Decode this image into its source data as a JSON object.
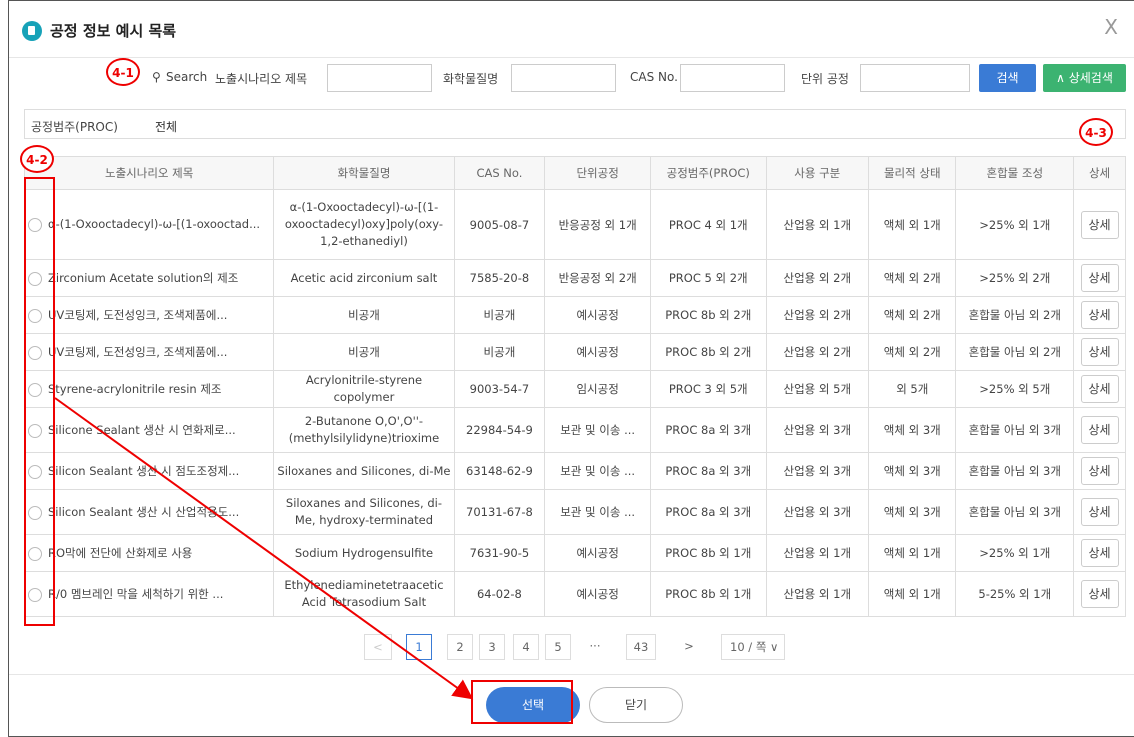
{
  "dialog": {
    "title": "공정 정보 예시 목록",
    "close_glyph": "X"
  },
  "search": {
    "search_label": "Search",
    "scenario_label": "노출시나리오 제목",
    "chemical_label": "화학물질명",
    "cas_label": "CAS No.",
    "unit_label": "단위 공정",
    "search_button": "검색",
    "advanced_button": "∧ 상세검색"
  },
  "filter": {
    "label": "공정범주(PROC)",
    "value": "전체"
  },
  "table": {
    "headers": [
      "노출시나리오 제목",
      "화학물질명",
      "CAS No.",
      "단위공정",
      "공정범주(PROC)",
      "사용 구분",
      "물리적 상태",
      "혼합물 조성",
      "상세"
    ],
    "rows": [
      {
        "title": "α-(1-Oxooctadecyl)-ω-[(1-oxooctad...",
        "chemical": "α-(1-Oxooctadecyl)-ω-[(1-oxooctadecyl)oxy]poly(oxy-1,2-ethanediyl)",
        "cas": "9005-08-7",
        "unit": "반응공정 외 1개",
        "proc": "PROC 4 외 1개",
        "use": "산업용 외 1개",
        "state": "액체 외 1개",
        "mix": ">25% 외 1개",
        "detail": "상세"
      },
      {
        "title": "Zirconium Acetate solution의 제조",
        "chemical": "Acetic acid zirconium salt",
        "cas": "7585-20-8",
        "unit": "반응공정 외 2개",
        "proc": "PROC 5 외 2개",
        "use": "산업용 외 2개",
        "state": "액체 외 2개",
        "mix": ">25% 외 2개",
        "detail": "상세"
      },
      {
        "title": "UV코팅제, 도전성잉크, 조색제품에...",
        "chemical": "비공개",
        "cas": "비공개",
        "unit": "예시공정",
        "proc": "PROC 8b 외 2개",
        "use": "산업용 외 2개",
        "state": "액체 외 2개",
        "mix": "혼합물 아님 외 2개",
        "detail": "상세"
      },
      {
        "title": "UV코팅제, 도전성잉크, 조색제품에...",
        "chemical": "비공개",
        "cas": "비공개",
        "unit": "예시공정",
        "proc": "PROC 8b 외 2개",
        "use": "산업용 외 2개",
        "state": "액체 외 2개",
        "mix": "혼합물 아님 외 2개",
        "detail": "상세"
      },
      {
        "title": "Styrene-acrylonitrile resin 제조",
        "chemical": "Acrylonitrile-styrene copolymer",
        "cas": "9003-54-7",
        "unit": "임시공정",
        "proc": "PROC 3 외 5개",
        "use": "산업용 외 5개",
        "state": "외 5개",
        "mix": ">25% 외 5개",
        "detail": "상세"
      },
      {
        "title": "Silicone Sealant 생산 시 연화제로...",
        "chemical": "2-Butanone O,O',O''-(methylsilylidyne)trioxime",
        "cas": "22984-54-9",
        "unit": "보관 및 이송 ...",
        "proc": "PROC 8a 외 3개",
        "use": "산업용 외 3개",
        "state": "액체 외 3개",
        "mix": "혼합물 아님 외 3개",
        "detail": "상세"
      },
      {
        "title": "Silicon Sealant 생산 시 점도조정제...",
        "chemical": "Siloxanes and Silicones, di-Me",
        "cas": "63148-62-9",
        "unit": "보관 및 이송 ...",
        "proc": "PROC 8a 외 3개",
        "use": "산업용 외 3개",
        "state": "액체 외 3개",
        "mix": "혼합물 아님 외 3개",
        "detail": "상세"
      },
      {
        "title": "Silicon Sealant 생산 시 산업적용도...",
        "chemical": "Siloxanes and Silicones, di-Me, hydroxy-terminated",
        "cas": "70131-67-8",
        "unit": "보관 및 이송 ...",
        "proc": "PROC 8a 외 3개",
        "use": "산업용 외 3개",
        "state": "액체 외 3개",
        "mix": "혼합물 아님 외 3개",
        "detail": "상세"
      },
      {
        "title": "RO막에 전단에 산화제로 사용",
        "chemical": "Sodium Hydrogensulfite",
        "cas": "7631-90-5",
        "unit": "예시공정",
        "proc": "PROC 8b 외 1개",
        "use": "산업용 외 1개",
        "state": "액체 외 1개",
        "mix": ">25% 외 1개",
        "detail": "상세"
      },
      {
        "title": "R/0 멤브레인 막을 세척하기 위한 ...",
        "chemical": "Ethylenediaminetetraacetic Acid Tetrasodium Salt",
        "cas": "64-02-8",
        "unit": "예시공정",
        "proc": "PROC 8b 외 1개",
        "use": "산업용 외 1개",
        "state": "액체 외 1개",
        "mix": "5-25% 외 1개",
        "detail": "상세"
      }
    ]
  },
  "pagination": {
    "prev": "<",
    "pages": [
      "1",
      "2",
      "3",
      "4",
      "5"
    ],
    "ellipsis": "···",
    "last": "43",
    "next": ">",
    "page_size": "10 / 쪽 ∨",
    "current": "1"
  },
  "footer": {
    "select_button": "선택",
    "close_button": "닫기"
  },
  "annotations": {
    "c41": "4-1",
    "c42": "4-2",
    "c43": "4-3"
  },
  "colors": {
    "primary": "#3a7bd5",
    "advanced": "#3cb371",
    "annotation": "#e00000"
  }
}
